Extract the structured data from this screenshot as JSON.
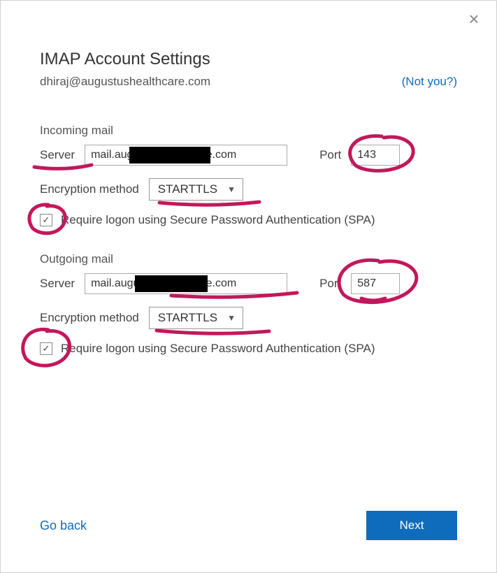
{
  "header": {
    "title": "IMAP Account Settings",
    "email": "dhiraj@augustushealthcare.com",
    "not_you": "(Not you?)"
  },
  "incoming": {
    "section": "Incoming mail",
    "server_label": "Server",
    "server_value": "mail.augustushealthcare.com",
    "port_label": "Port",
    "port_value": "143",
    "enc_label": "Encryption method",
    "enc_value": "STARTTLS",
    "spa_label": "Require logon using Secure Password Authentication (SPA)"
  },
  "outgoing": {
    "section": "Outgoing mail",
    "server_label": "Server",
    "server_value": "mail.augustushealthcare.com",
    "port_label": "Port",
    "port_value": "587",
    "enc_label": "Encryption method",
    "enc_value": "STARTTLS",
    "spa_label": "Require logon using Secure Password Authentication (SPA)"
  },
  "footer": {
    "back": "Go back",
    "next": "Next"
  },
  "colors": {
    "accent": "#0f6cbd",
    "annotation": "#c2185b"
  }
}
